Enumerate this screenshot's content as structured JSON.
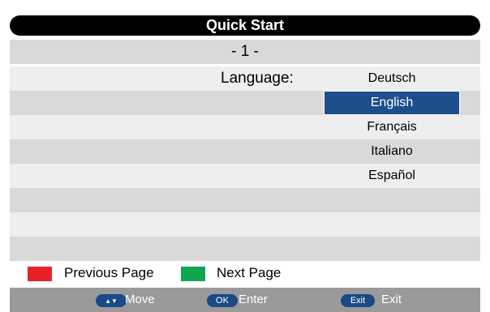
{
  "title": "Quick Start",
  "page_number": "- 1 -",
  "language": {
    "label": "Language:",
    "options": [
      "Deutsch",
      "English",
      "Français",
      "Italiano",
      "Español"
    ],
    "selected": "English"
  },
  "legend": {
    "previous_label": "Previous Page",
    "next_label": "Next Page",
    "previous_color": "#e8202a",
    "next_color": "#10a550"
  },
  "footer": {
    "move_key": "▲▼",
    "move_label": "Move",
    "ok_key": "OK",
    "enter_label": "Enter",
    "exit_key": "Exit",
    "exit_label": "Exit"
  },
  "colors": {
    "selected_bg": "#1f4e8c",
    "pill_bg": "#1a4a86",
    "footer_bg": "#9a9a9a"
  }
}
